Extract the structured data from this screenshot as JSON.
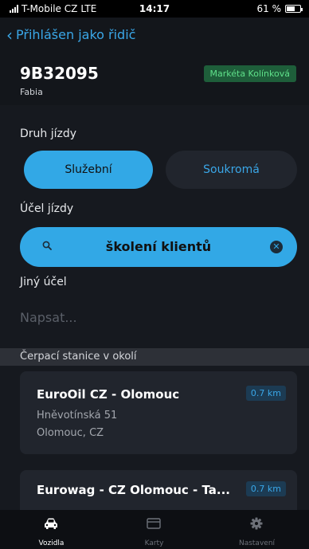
{
  "status_bar": {
    "carrier": "T-Mobile CZ",
    "network": "LTE",
    "time": "14:17",
    "battery_text": "61 %",
    "battery_level": 0.61
  },
  "header": {
    "back_label": "Přihlášen jako řidič",
    "plate": "9B32095",
    "model": "Fabia",
    "driver_badge": "Markéta Kolínková"
  },
  "trip_type": {
    "label": "Druh jízdy",
    "options": [
      "Služební",
      "Soukromá"
    ],
    "selected": "Služební"
  },
  "trip_purpose": {
    "label": "Účel jízdy",
    "value": "školení klientů"
  },
  "other_purpose": {
    "label": "Jiný účel",
    "placeholder": "Napsat..."
  },
  "stations": {
    "section_title": "Čerpací stanice v okolí",
    "items": [
      {
        "name": "EuroOil CZ - Olomouc",
        "street": "Hněvotínská 51",
        "city": "Olomouc, CZ",
        "distance": "0.7 km"
      },
      {
        "name": "Eurowag - CZ Olomouc - Ta...",
        "distance": "0.7 km"
      }
    ]
  },
  "tab_bar": {
    "tabs": [
      {
        "label": "Vozidla",
        "icon": "car-icon",
        "active": true
      },
      {
        "label": "Karty",
        "icon": "card-icon",
        "active": false
      },
      {
        "label": "Nastavení",
        "icon": "gear-icon",
        "active": false
      }
    ]
  },
  "colors": {
    "accent": "#32a8e6",
    "background": "#16191f",
    "card": "#21252d",
    "badge_green": "#5fe08a"
  }
}
